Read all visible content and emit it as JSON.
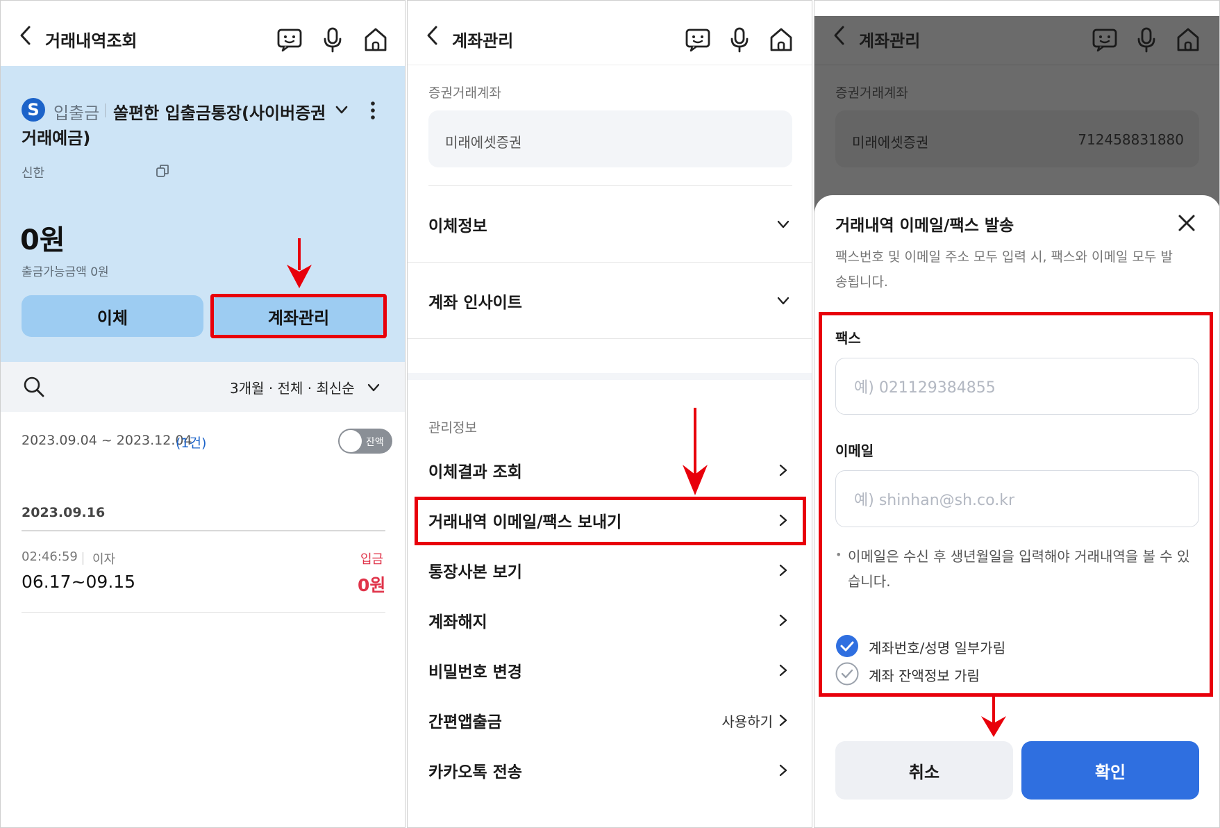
{
  "panel1": {
    "header": {
      "title": "거래내역조회"
    },
    "account": {
      "type": "입출금",
      "name_line1": "쏠편한 입출금통장(사이버증권",
      "name_line2": "거래예금)",
      "bank": "신한",
      "balance": "0원",
      "available": "출금가능금액 0원",
      "transfer_label": "이체",
      "manage_label": "계좌관리"
    },
    "filter": {
      "label": "3개월 · 전체 · 최신순"
    },
    "period": {
      "range": "2023.09.04 ~ 2023.12.04",
      "count": "(1건)",
      "toggle_label": "잔액"
    },
    "date_group": "2023.09.16",
    "transaction": {
      "time": "02:46:59",
      "kind": "이자",
      "type": "입금",
      "desc": "06.17~09.15",
      "amount": "0원"
    }
  },
  "panel2": {
    "header": {
      "title": "계좌관리"
    },
    "securities": {
      "section": "증권거래계좌",
      "broker": "미래에셋증권"
    },
    "accordions": [
      {
        "label": "이체정보"
      },
      {
        "label": "계좌 인사이트"
      }
    ],
    "manage_section": "관리정보",
    "menu": [
      {
        "label": "이체결과 조회"
      },
      {
        "label": "거래내역 이메일/팩스 보내기"
      },
      {
        "label": "통장사본 보기"
      },
      {
        "label": "계좌해지"
      },
      {
        "label": "비밀번호 변경"
      },
      {
        "label": "간편앱출금",
        "extra": "사용하기"
      },
      {
        "label": "카카오톡 전송"
      }
    ]
  },
  "panel3": {
    "header": {
      "title": "계좌관리"
    },
    "securities": {
      "section": "증권거래계좌",
      "broker": "미래에셋증권",
      "account_no": "712458831880"
    },
    "sheet": {
      "title": "거래내역 이메일/팩스 발송",
      "desc_line1": "팩스번호 및 이메일 주소 모두 입력 시, 팩스와 이메일 모두 발",
      "desc_line2": "송됩니다.",
      "fax_label": "팩스",
      "fax_placeholder": "예) 021129384855",
      "email_label": "이메일",
      "email_placeholder": "예) shinhan@sh.co.kr",
      "note_line1": "이메일은 수신 후 생년월일을 입력해야 거래내역을 볼 수 있",
      "note_line2": "습니다.",
      "option1": "계좌번호/성명 일부가림",
      "option2": "계좌 잔액정보 가림",
      "cancel_label": "취소",
      "confirm_label": "확인"
    }
  },
  "colors": {
    "accent_red": "#e8000b",
    "primary_blue": "#2f6fe0",
    "light_blue": "#cde4f6",
    "button_blue": "#9dccf2"
  }
}
